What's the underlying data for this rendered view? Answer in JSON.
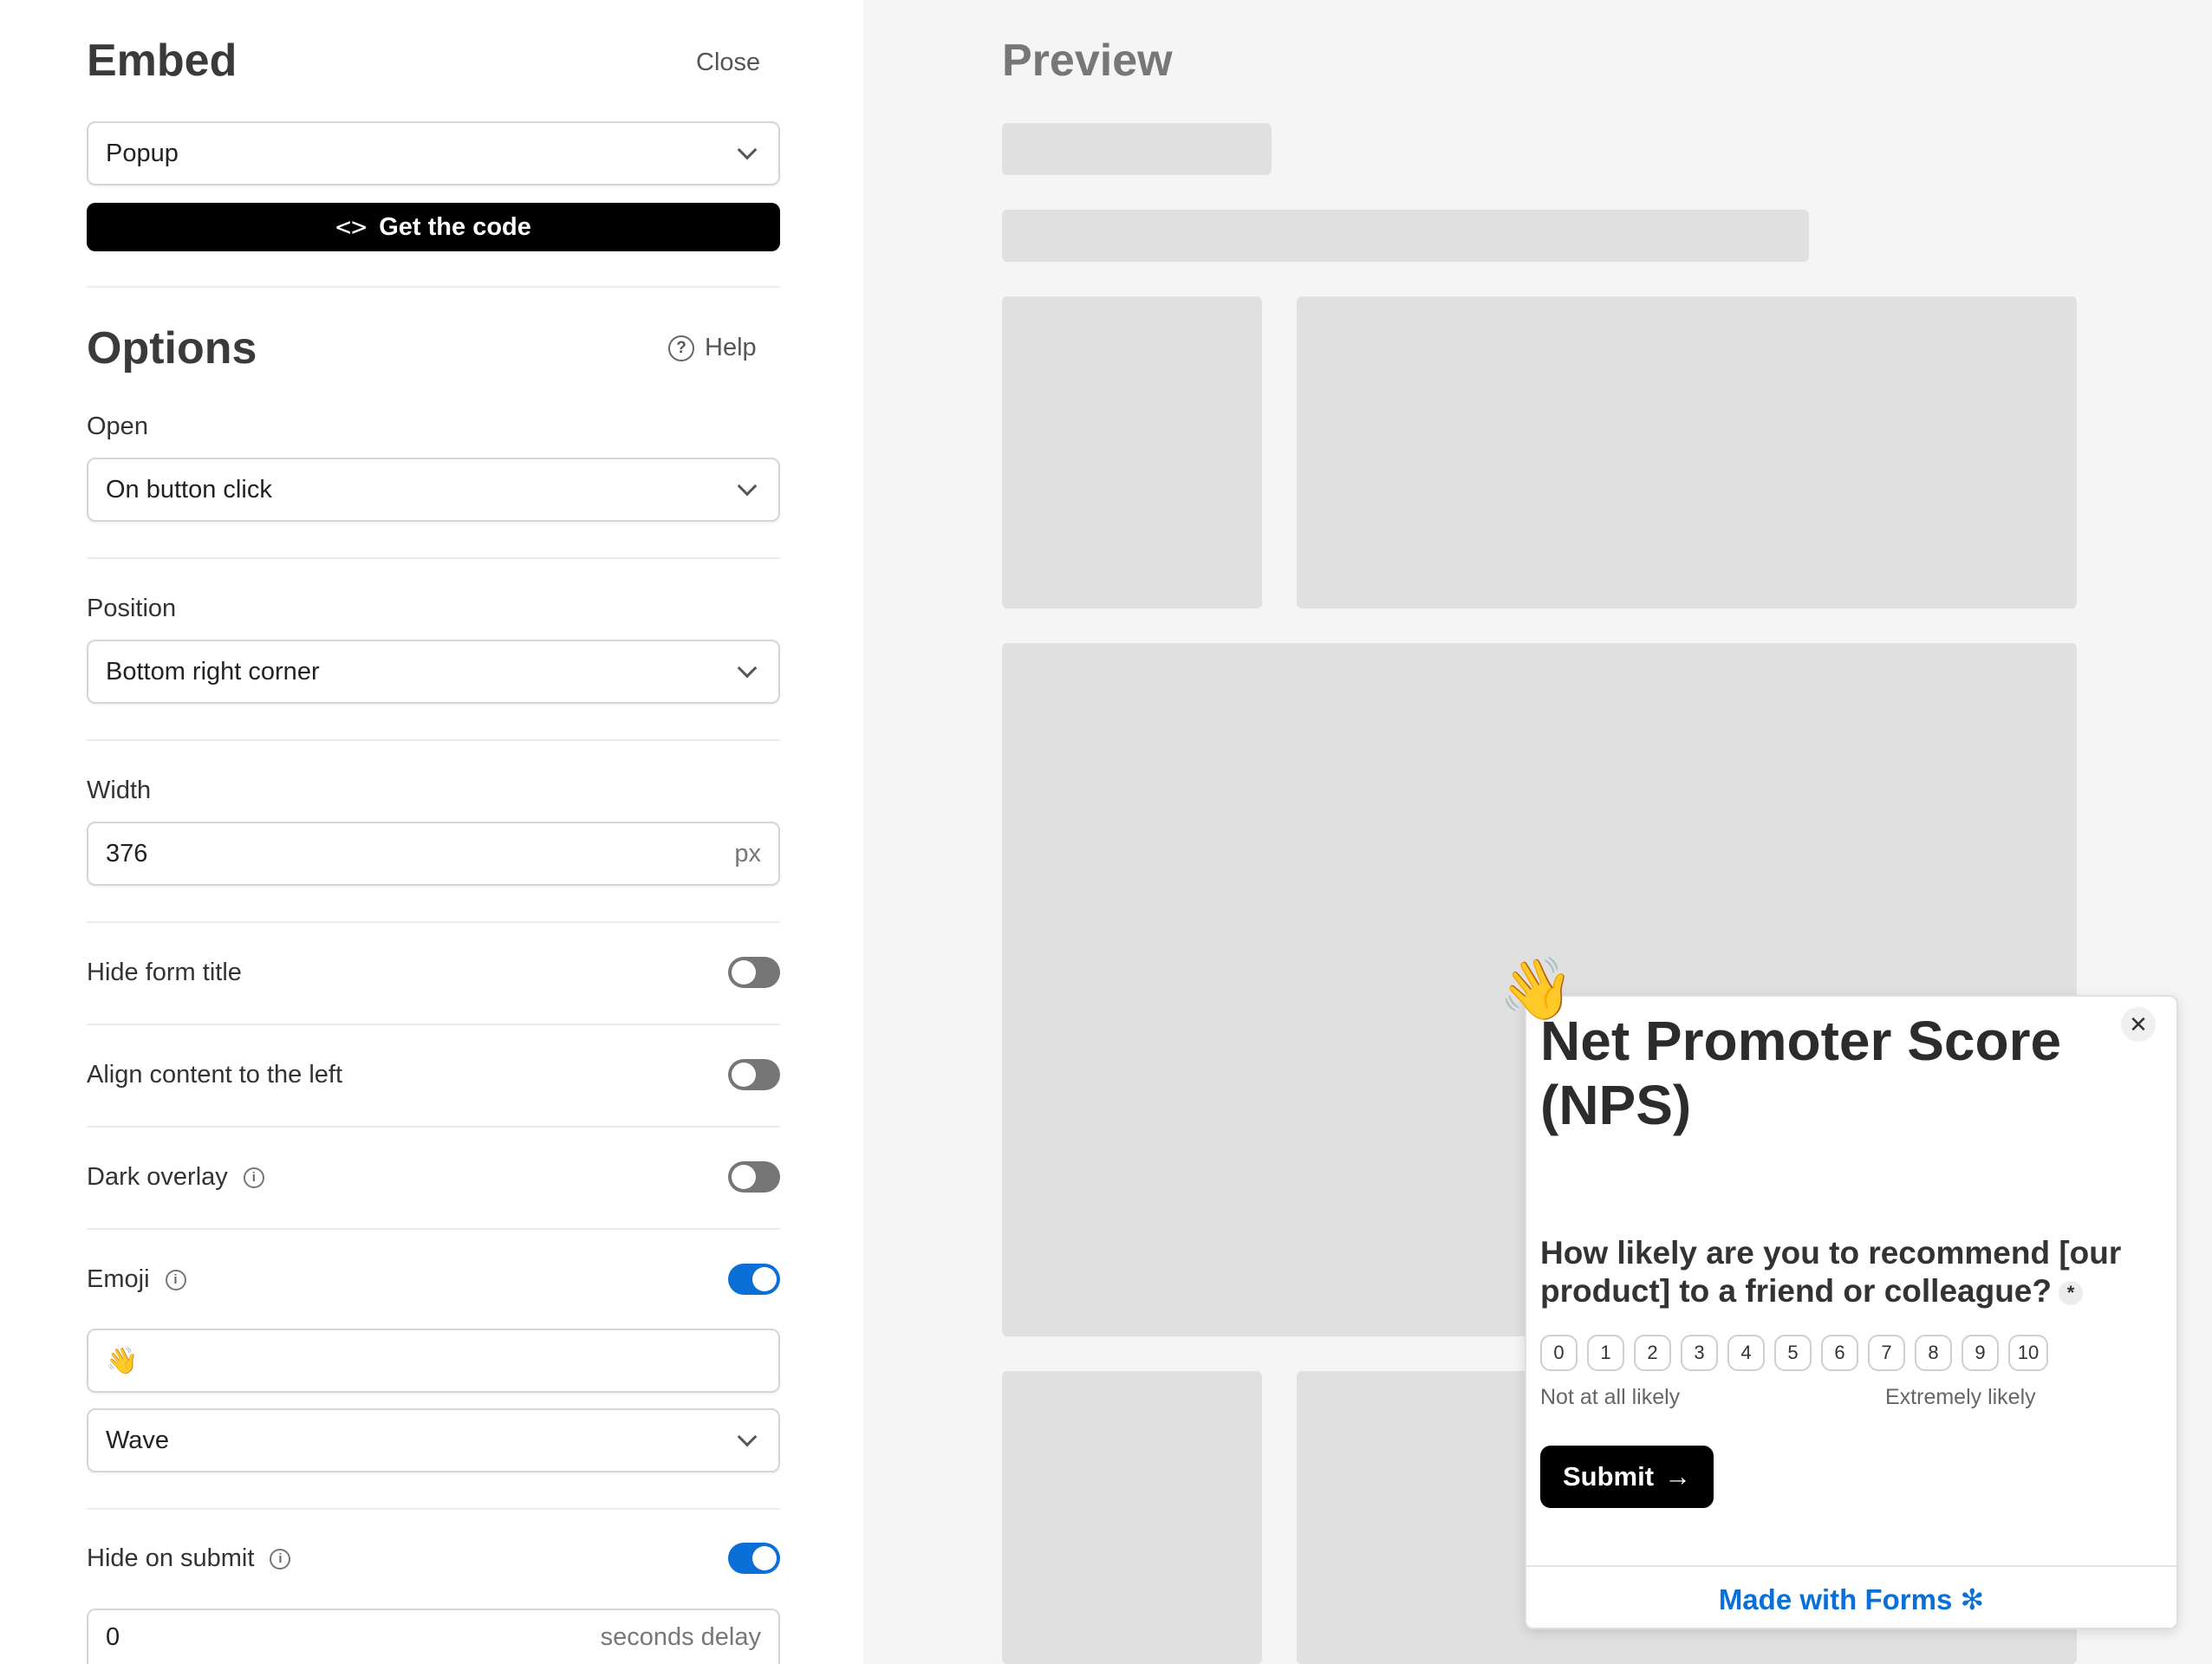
{
  "embed": {
    "title": "Embed",
    "close_label": "Close",
    "type_select": "Popup",
    "get_code_label": "Get the code"
  },
  "options": {
    "title": "Options",
    "help_label": "Help",
    "open_label": "Open",
    "open_value": "On button click",
    "position_label": "Position",
    "position_value": "Bottom right corner",
    "width_label": "Width",
    "width_value": "376",
    "width_unit": "px",
    "hide_title_label": "Hide form title",
    "hide_title_on": false,
    "align_left_label": "Align content to the left",
    "align_left_on": false,
    "dark_overlay_label": "Dark overlay",
    "dark_overlay_on": false,
    "emoji_label": "Emoji",
    "emoji_on": true,
    "emoji_value": "👋",
    "emoji_animation": "Wave",
    "hide_submit_label": "Hide on submit",
    "hide_submit_on": true,
    "delay_value": "0",
    "delay_unit": "seconds delay"
  },
  "preview": {
    "title": "Preview",
    "popup": {
      "emoji": "👋",
      "title": "Net Promoter Score (NPS)",
      "question": "How likely are you to recommend [our product] to a friend or colleague?",
      "required_mark": "*",
      "scale": [
        "0",
        "1",
        "2",
        "3",
        "4",
        "5",
        "6",
        "7",
        "8",
        "9",
        "10"
      ],
      "scale_low": "Not at all likely",
      "scale_high": "Extremely likely",
      "submit_label": "Submit",
      "footer": "Made with Forms"
    }
  },
  "colors": {
    "accent": "#0a6fd6",
    "toggle_off": "#767676",
    "skeleton": "#e0e0e0"
  }
}
